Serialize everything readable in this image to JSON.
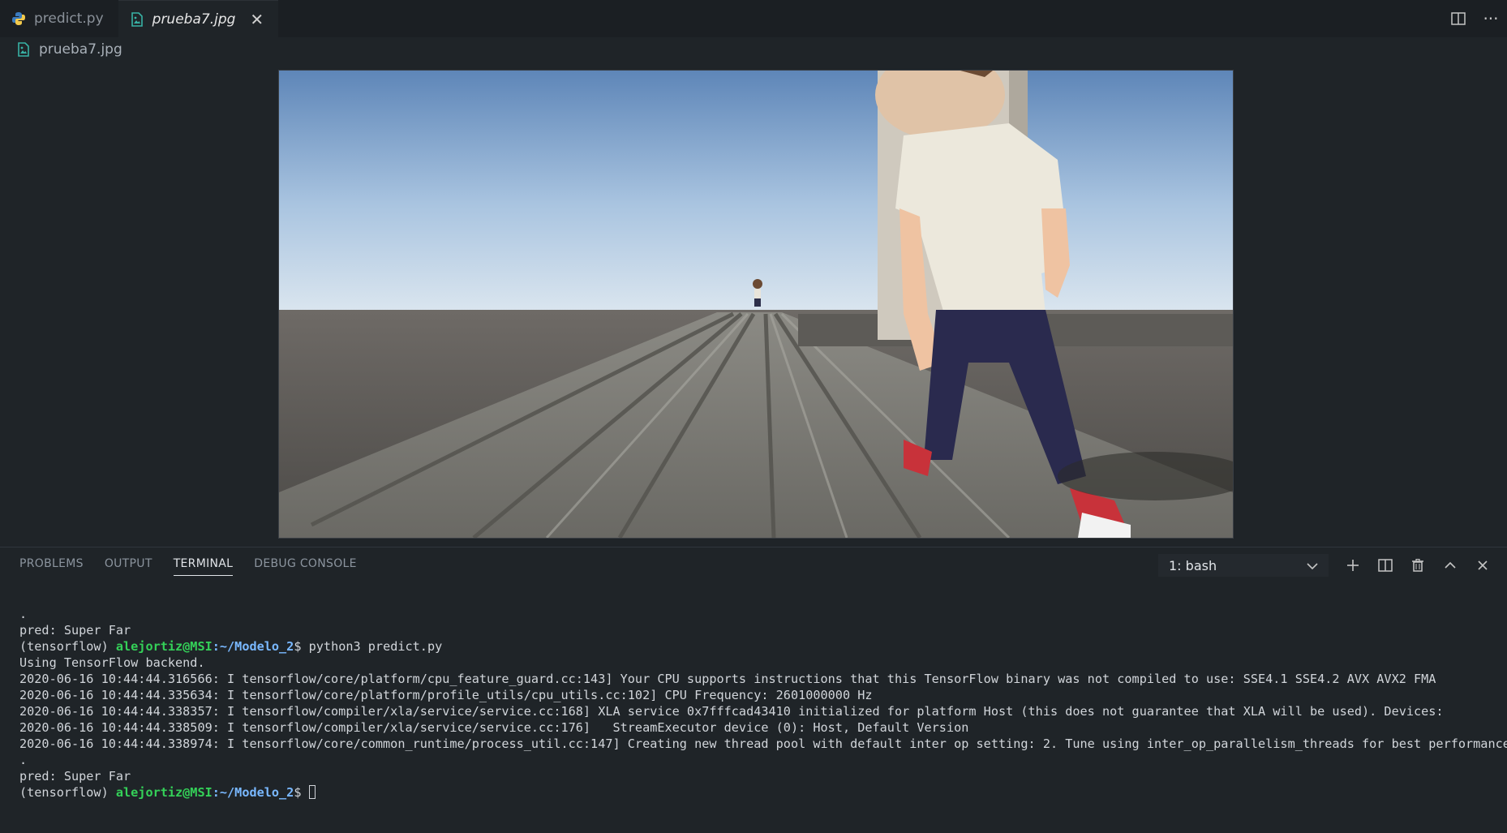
{
  "tabs": [
    {
      "label": "predict.py",
      "icon": "python-icon",
      "active": false
    },
    {
      "label": "prueba7.jpg",
      "icon": "image-file-icon",
      "active": true
    }
  ],
  "breadcrumb": {
    "label": "prueba7.jpg",
    "icon": "image-file-icon"
  },
  "editor_actions": [
    {
      "icon": "split-editor-icon"
    },
    {
      "icon": "more-actions-icon"
    }
  ],
  "panel": {
    "tabs": [
      "PROBLEMS",
      "OUTPUT",
      "TERMINAL",
      "DEBUG CONSOLE"
    ],
    "active_tab": "TERMINAL",
    "terminal_select": "1: bash",
    "actions": [
      "add-terminal-icon",
      "split-terminal-icon",
      "trash-icon",
      "maximize-panel-icon",
      "close-panel-icon"
    ]
  },
  "terminal": {
    "line_dot_1": ".",
    "pred_1": "pred: Super Far",
    "prompt_env": "(tensorflow) ",
    "prompt_user": "alejortiz@MSI",
    "prompt_path": ":~/Modelo_2",
    "prompt_sign": "$ ",
    "command": "python3 predict.py",
    "backend": "Using TensorFlow backend.",
    "log_1": "2020-06-16 10:44:44.316566: I tensorflow/core/platform/cpu_feature_guard.cc:143] Your CPU supports instructions that this TensorFlow binary was not compiled to use: SSE4.1 SSE4.2 AVX AVX2 FMA",
    "log_2": "2020-06-16 10:44:44.335634: I tensorflow/core/platform/profile_utils/cpu_utils.cc:102] CPU Frequency: 2601000000 Hz",
    "log_3": "2020-06-16 10:44:44.338357: I tensorflow/compiler/xla/service/service.cc:168] XLA service 0x7fffcad43410 initialized for platform Host (this does not guarantee that XLA will be used). Devices:",
    "log_4": "2020-06-16 10:44:44.338509: I tensorflow/compiler/xla/service/service.cc:176]   StreamExecutor device (0): Host, Default Version",
    "log_5": "2020-06-16 10:44:44.338974: I tensorflow/core/common_runtime/process_util.cc:147] Creating new thread pool with default inter op setting: 2. Tune using inter_op_parallelism_threads for best performance",
    "line_dot_2": ".",
    "pred_2": "pred: Super Far"
  },
  "colors": {
    "background": "#1f2428",
    "tabbar": "#1b1f23",
    "prompt_user": "#34d058",
    "prompt_path": "#79b8ff"
  }
}
